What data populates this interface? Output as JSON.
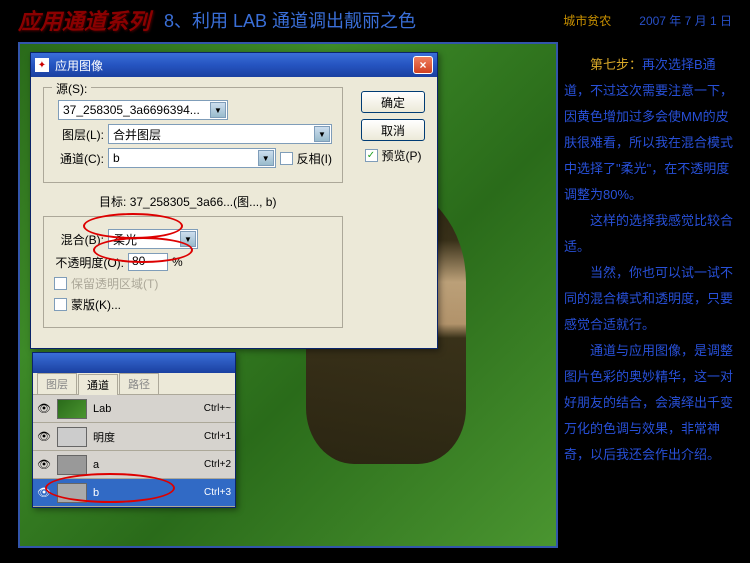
{
  "header": {
    "title_red": "应用通道系列",
    "title_blue": "8、利用 LAB 通道调出靓丽之色",
    "author": "城市贫农",
    "date": "2007 年 7 月 1 日"
  },
  "dialog": {
    "title": "应用图像",
    "close_icon": "×",
    "group_source": "源(S):",
    "source_value": "37_258305_3a6696394...",
    "layer_label": "图层(L):",
    "layer_value": "合并图层",
    "channel_label": "通道(C):",
    "channel_value": "b",
    "invert_label": "反相(I)",
    "target_label": "目标:",
    "target_value": "37_258305_3a66...(图..., b)",
    "blend_label": "混合(B):",
    "blend_value": "柔光",
    "opacity_label": "不透明度(O):",
    "opacity_value": "80",
    "opacity_unit": "%",
    "preserve_label": "保留透明区域(T)",
    "mask_label": "蒙版(K)...",
    "ok": "确定",
    "cancel": "取消",
    "preview": "预览(P)"
  },
  "channels": {
    "tabs": [
      "图层",
      "通道",
      "路径"
    ],
    "active_tab": 1,
    "rows": [
      {
        "name": "Lab",
        "shortcut": "Ctrl+~",
        "thumb": "lab"
      },
      {
        "name": "明度",
        "shortcut": "Ctrl+1",
        "thumb": "light"
      },
      {
        "name": "a",
        "shortcut": "Ctrl+2",
        "thumb": "a"
      },
      {
        "name": "b",
        "shortcut": "Ctrl+3",
        "thumb": "b",
        "selected": true
      }
    ],
    "eye_icon": "👁"
  },
  "sidebar": {
    "step_label": "第七步：",
    "p1": "再次选择B通道，不过这次需要注意一下，因黄色增加过多会使MM的皮肤很难看，所以我在混合模式中选择了\"柔光\"，在不透明度调整为80%。",
    "p2": "这样的选择我感觉比较合适。",
    "p3": "当然，你也可以试一试不同的混合模式和透明度，只要感觉合适就行。",
    "p4": "通道与应用图像，是调整图片色彩的奥妙精华，这一对好朋友的结合，会演绎出千变万化的色调与效果，非常神奇，以后我还会作出介绍。"
  }
}
